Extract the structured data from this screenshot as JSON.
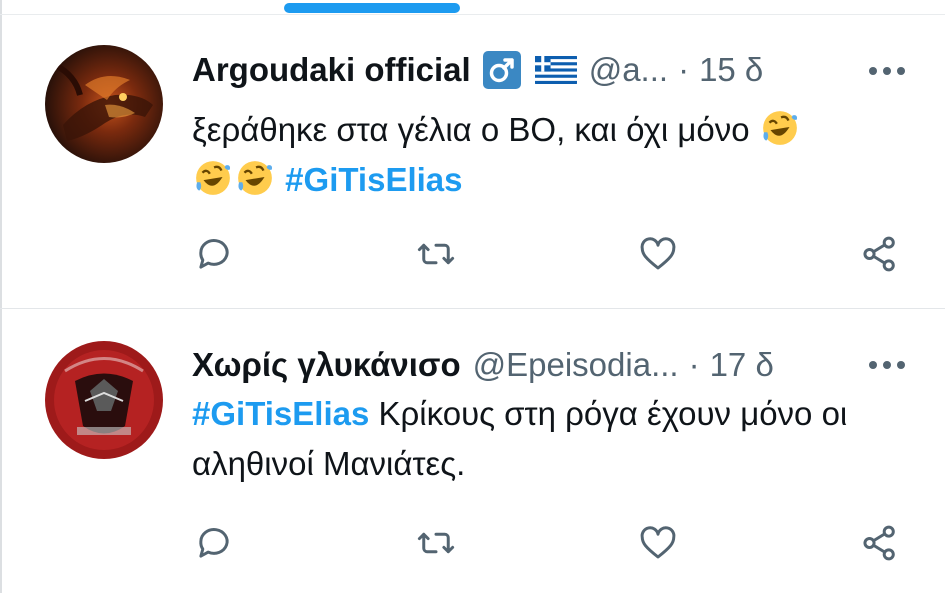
{
  "tweets": [
    {
      "display_name": "Argoudaki official",
      "handle": "@a...",
      "separator": "·",
      "time": "15 δ",
      "text_before": "ξεράθηκε στα γέλια ο ΒΟ, και όχι μόνο",
      "hashtag": "#GiTisElias",
      "text_after": "",
      "badges": [
        "male-sign-icon",
        "greece-flag-icon"
      ],
      "emoji": "rolling-on-the-floor-laughing"
    },
    {
      "display_name": "Χωρίς γλυκάνισο",
      "handle": "@Epeisodia...",
      "separator": "·",
      "time": "17 δ",
      "hashtag": "#GiTisElias",
      "text_after": "Κρίκους στη ρόγα έχουν μόνο οι αληθινοί Μανιάτες."
    }
  ],
  "actions": [
    "reply-icon",
    "retweet-icon",
    "like-icon",
    "share-icon"
  ],
  "colors": {
    "accent": "#1d9bf0",
    "secondary_text": "#536471",
    "primary_text": "#0f1419"
  }
}
